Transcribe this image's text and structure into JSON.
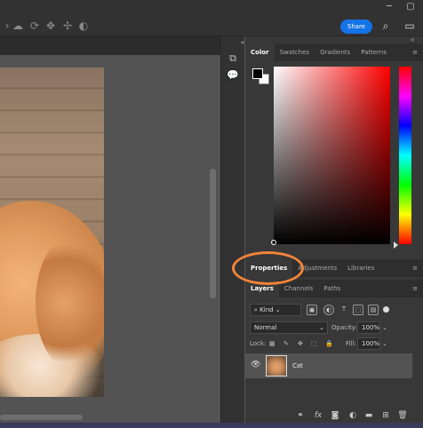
{
  "options_bar": {
    "share_label": "Share"
  },
  "color_panel": {
    "tabs": [
      "Color",
      "Swatches",
      "Gradients",
      "Patterns"
    ],
    "active_tab": "Color"
  },
  "properties_panel": {
    "tabs": [
      "Properties",
      "Adjustments",
      "Libraries"
    ],
    "active_tab": "Properties"
  },
  "layers_panel": {
    "tabs": [
      "Layers",
      "Channels",
      "Paths"
    ],
    "active_tab": "Layers",
    "filter_kind": "Kind",
    "blend_mode": "Normal",
    "opacity_label": "Opacity:",
    "opacity_value": "100%",
    "lock_label": "Lock:",
    "fill_label": "Fill:",
    "fill_value": "100%",
    "layers": [
      {
        "name": "Cat",
        "visible": true
      }
    ]
  },
  "colors": {
    "accent": "#1473e6",
    "highlight_ring": "#f3843a",
    "foreground_swatch": "#000000",
    "background_swatch": "#ffffff"
  },
  "icons": {
    "window_controls": [
      "minimize-icon",
      "maximize-icon"
    ],
    "options_bar": [
      "cloud-icon",
      "rotate-icon",
      "pan-icon",
      "move-icon",
      "video-icon",
      "search-icon",
      "layout-icon"
    ],
    "layers_bottom": [
      "link-icon",
      "fx-icon",
      "mask-icon",
      "adjustment-icon",
      "folder-icon",
      "new-layer-icon",
      "trash-icon"
    ]
  }
}
